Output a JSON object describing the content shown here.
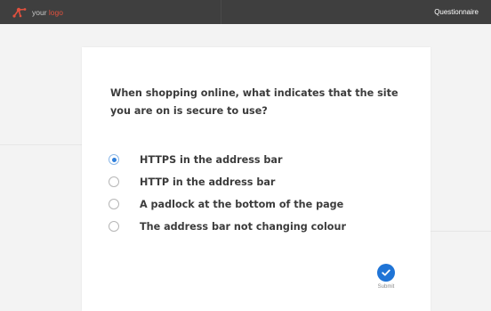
{
  "header": {
    "logo_prefix": "your ",
    "logo_word": "logo",
    "nav_label": "Questionnaire"
  },
  "question": {
    "text": "When shopping online, what indicates that the site you are on is secure to use?",
    "options": [
      {
        "label": "HTTPS in the address bar",
        "selected": true
      },
      {
        "label": "HTTP in the address bar",
        "selected": false
      },
      {
        "label": "A padlock at the bottom of the page",
        "selected": false
      },
      {
        "label": "The address bar not changing colour",
        "selected": false
      }
    ]
  },
  "submit": {
    "label": "Submit"
  },
  "colors": {
    "header_bg": "#3f3f3f",
    "logo_accent": "#e0513e",
    "primary": "#1f74d6",
    "page_bg": "#f3f3f3"
  }
}
